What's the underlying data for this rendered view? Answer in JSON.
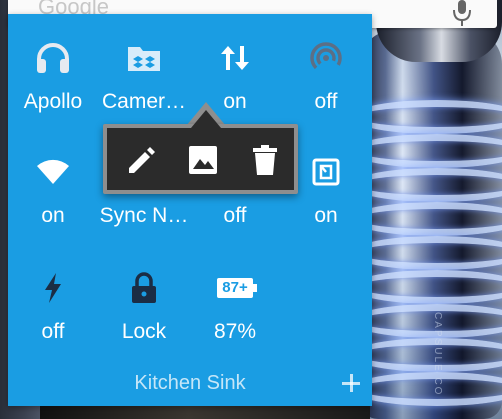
{
  "search": {
    "placeholder": "Google"
  },
  "widget": {
    "tiles": [
      {
        "label": "Apollo",
        "icon": "headphones-icon"
      },
      {
        "label": "Camer…",
        "icon": "dropbox-folder-icon"
      },
      {
        "label": "on",
        "icon": "data-sync-arrows-icon"
      },
      {
        "label": "off",
        "icon": "hotspot-icon"
      },
      {
        "label": "on",
        "icon": "wifi-icon"
      },
      {
        "label": "Sync N…",
        "icon": "sync-icon"
      },
      {
        "label": "off",
        "icon": "airplane-mode-icon"
      },
      {
        "label": "on",
        "icon": "nfc-icon"
      },
      {
        "label": "off",
        "icon": "flashlight-icon"
      },
      {
        "label": "Lock",
        "icon": "lock-icon"
      },
      {
        "label": "87%",
        "icon": "battery-icon"
      }
    ],
    "battery_icon_text": "87+",
    "footer_label": "Kitchen Sink"
  },
  "popup": {
    "actions": [
      "edit-icon",
      "image-icon",
      "trash-icon"
    ]
  },
  "wallpaper": {
    "jar_text": "CAPSULE CO"
  },
  "colors": {
    "panel": "#1a9de3",
    "popup": "#2b2b2b",
    "popup_border": "#8e8e8e",
    "text": "#ffffff"
  }
}
